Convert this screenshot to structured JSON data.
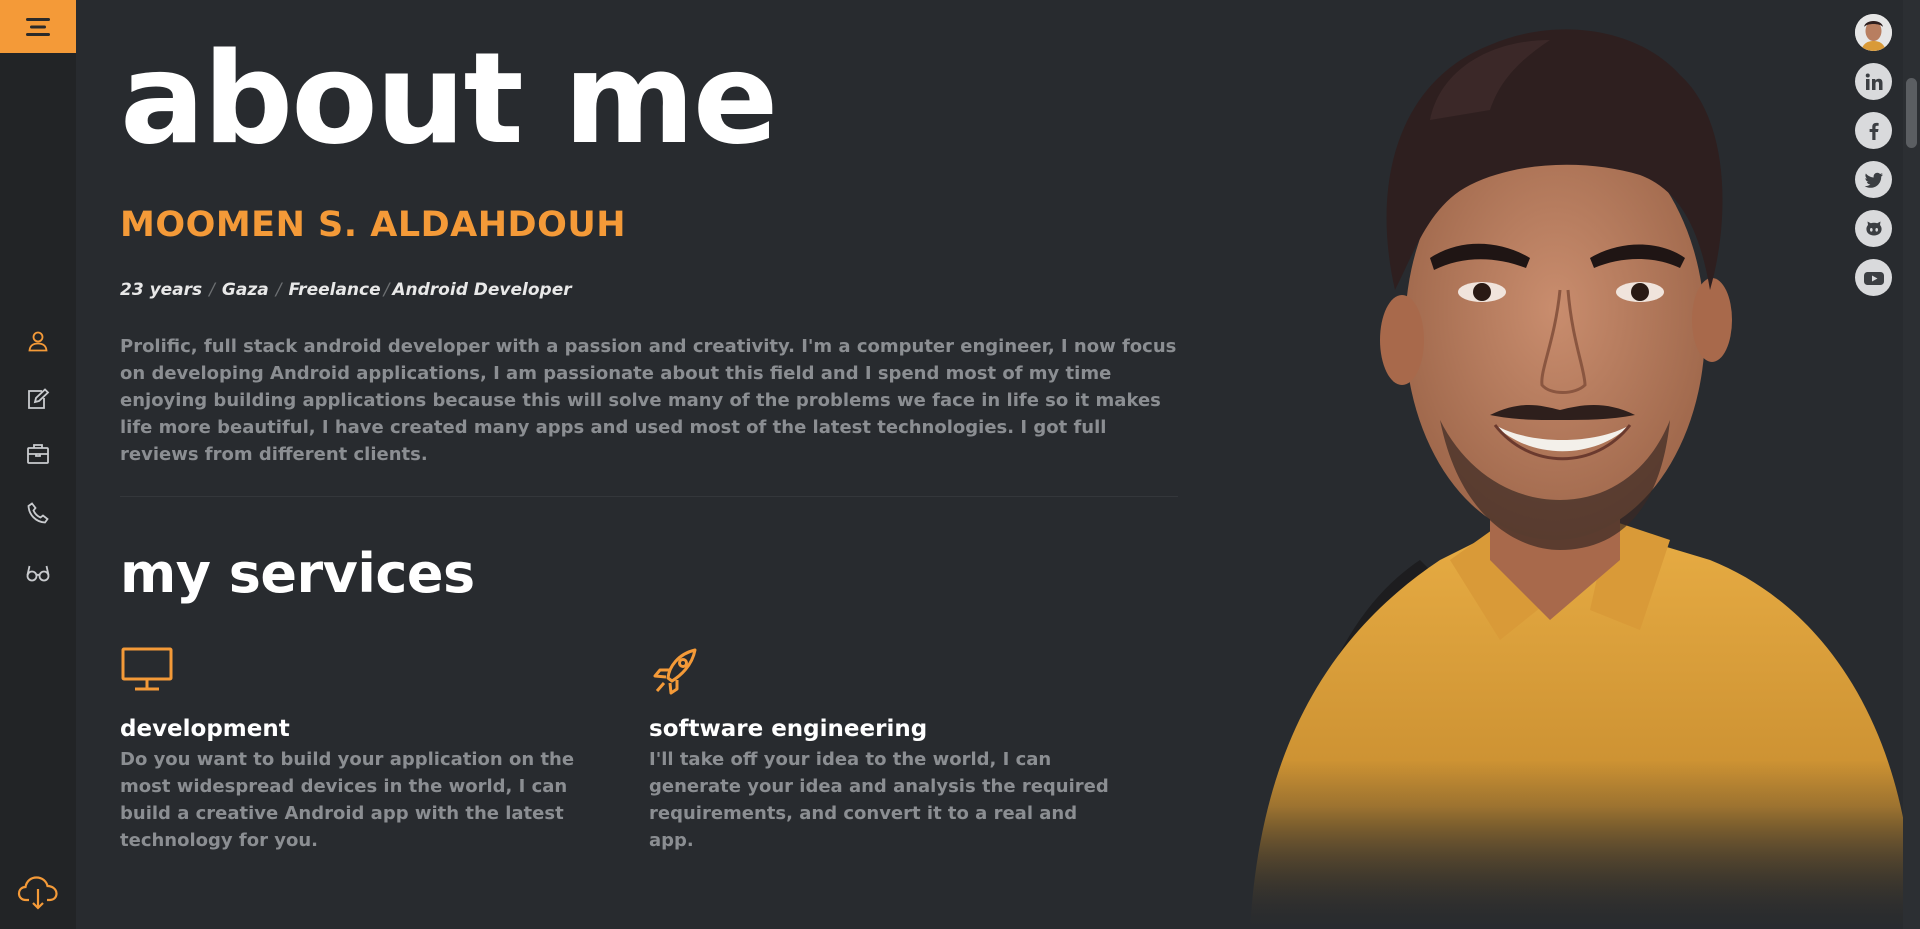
{
  "sidebar": {
    "menu_icon": "hamburger-icon",
    "nav_icons": [
      "user-icon",
      "edit-icon",
      "briefcase-icon",
      "phone-icon",
      "glasses-icon"
    ],
    "download_icon": "cloud-download-icon"
  },
  "about": {
    "title": "about me",
    "name": "MOOMEN S. ALDAHDOUH",
    "meta": [
      "23 years",
      "Gaza",
      "Freelance",
      "Android Developer"
    ],
    "separator": "/",
    "bio": "Prolific, full stack android developer with a passion and creativity. I'm a computer engineer, I now focus on developing Android applications, I am passionate about this field and I spend most of my time enjoying building applications because this will solve many of the problems we face in life so it makes life more beautiful, I have created many apps and used most of the latest technologies. I got full reviews from different clients."
  },
  "services": {
    "title": "my services",
    "items": [
      {
        "icon": "monitor-icon",
        "title": "development",
        "description": "Do you want to build your application on the most widespread devices in the world, I can build a creative Android app with the latest technology for you."
      },
      {
        "icon": "rocket-icon",
        "title": "software engineering",
        "description": "I'll take off your idea to the world, I can generate your idea and analysis the required requirements, and convert it to a real and app."
      }
    ]
  },
  "social": [
    "avatar",
    "linkedin-icon",
    "facebook-icon",
    "twitter-icon",
    "github-icon",
    "youtube-icon"
  ],
  "colors": {
    "accent": "#f49a38",
    "background": "#282b2f",
    "sidebar": "#222426",
    "muted_text": "#8b8e92",
    "shirt": "#e0a63e"
  }
}
